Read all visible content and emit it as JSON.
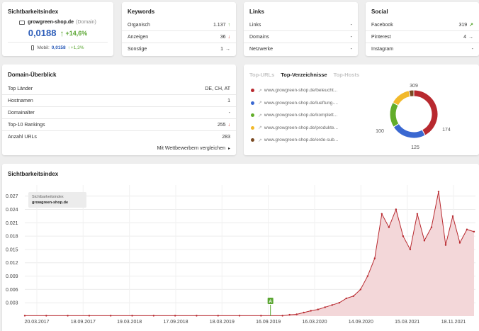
{
  "sichtbarkeit_card": {
    "title": "Sichtbarkeitsindex",
    "domain": "growgreen-shop.de",
    "domain_suffix": "(Domain)",
    "value": "0,0188",
    "change": "+14,6%",
    "mobile_label": "Mobil:",
    "mobile_value": "0,0158",
    "mobile_change": "+1,3%"
  },
  "keywords_card": {
    "title": "Keywords",
    "rows": [
      {
        "label": "Organisch",
        "value": "1.137",
        "trend": "↑",
        "trend_type": "up"
      },
      {
        "label": "Anzeigen",
        "value": "36",
        "trend": "↓",
        "trend_type": "down"
      },
      {
        "label": "Sonstige",
        "value": "1",
        "trend": "→",
        "trend_type": "right"
      }
    ]
  },
  "links_card": {
    "title": "Links",
    "rows": [
      {
        "label": "Links",
        "value": "-"
      },
      {
        "label": "Domains",
        "value": "-"
      },
      {
        "label": "Netzwerke",
        "value": "-"
      }
    ]
  },
  "social_card": {
    "title": "Social",
    "rows": [
      {
        "label": "Facebook",
        "value": "319",
        "trend": "↗",
        "trend_type": "up"
      },
      {
        "label": "Pinterest",
        "value": "4",
        "trend": "→",
        "trend_type": "right"
      },
      {
        "label": "Instagram",
        "value": "-",
        "trend": "",
        "trend_type": ""
      }
    ]
  },
  "domain_card": {
    "title": "Domain-Überblick",
    "rows": [
      {
        "label": "Top Länder",
        "value": "DE, CH, AT",
        "trend": "",
        "trend_type": ""
      },
      {
        "label": "Hostnamen",
        "value": "1",
        "trend": "",
        "trend_type": ""
      },
      {
        "label": "Domainalter",
        "value": "-",
        "trend": "",
        "trend_type": ""
      },
      {
        "label": "Top-10 Rankings",
        "value": "255",
        "trend": "↓",
        "trend_type": "down"
      },
      {
        "label": "Anzahl URLs",
        "value": "283",
        "trend": "",
        "trend_type": ""
      }
    ],
    "compare_link": "Mit Wettbewerbern vergleichen",
    "compare_arrow": "▸"
  },
  "top_card": {
    "tabs": [
      "Top-URLs",
      "Top-Verzeichnisse",
      "Top-Hosts"
    ],
    "active_tab": 1,
    "items": [
      {
        "url": "www.growgreen-shop.de/beleucht...",
        "color": "#b8292f"
      },
      {
        "url": "www.growgreen-shop.de/lueftung-...",
        "color": "#3a68d1"
      },
      {
        "url": "www.growgreen-shop.de/komplett...",
        "color": "#62ad2a"
      },
      {
        "url": "www.growgreen-shop.de/produkte...",
        "color": "#f2b92b"
      },
      {
        "url": "www.growgreen-shop.de/erde-sub...",
        "color": "#7a4a22"
      }
    ],
    "donut": {
      "values": [
        309,
        174,
        125,
        100,
        24
      ],
      "labels": [
        "309",
        "174",
        "125",
        "100"
      ]
    }
  },
  "chart_card": {
    "title": "Sichtbarkeitsindex",
    "legend_series_label": "Sichtbarkeitsindex",
    "legend_domain": "growgreen-shop.de",
    "marker_label": "A"
  },
  "chart_data": {
    "type": "area",
    "title": "Sichtbarkeitsindex",
    "series": [
      {
        "name": "growgreen-shop.de"
      }
    ],
    "y_ticks": [
      "0.027",
      "0.024",
      "0.021",
      "0.018",
      "0.015",
      "0.012",
      "0.009",
      "0.006",
      "0.003"
    ],
    "ylim": [
      0,
      0.0295
    ],
    "x_ticks": [
      "20.03.2017",
      "18.09.2017",
      "19.03.2018",
      "17.09.2018",
      "18.03.2019",
      "16.09.2019",
      "16.03.2020",
      "14.09.2020",
      "15.03.2021",
      "18.11.2021"
    ],
    "x": [
      "2016-12",
      "2017-03",
      "2017-06",
      "2017-09",
      "2017-12",
      "2018-03",
      "2018-06",
      "2018-09",
      "2018-12",
      "2019-03",
      "2019-06",
      "2019-09",
      "2019-12",
      "2020-03",
      "2020-05",
      "2020-07",
      "2020-08",
      "2020-09",
      "2020-10",
      "2020-11",
      "2020-12",
      "2021-01",
      "2021-02",
      "2021-03",
      "2021-04",
      "2021-05",
      "2021-06",
      "2021-06b",
      "2021-07",
      "2021-07b",
      "2021-08",
      "2021-08b",
      "2021-09",
      "2021-09b",
      "2021-10",
      "2021-10b",
      "2021-11",
      "2021-11b",
      "2021-12",
      "2022-01"
    ],
    "y": [
      0.0001,
      0.0001,
      0.0001,
      0.0001,
      0.0001,
      0.0001,
      0.0001,
      0.0001,
      0.0001,
      0.0001,
      0.0001,
      0.0001,
      0.0001,
      0.0003,
      0.0004,
      0.0008,
      0.0012,
      0.0015,
      0.002,
      0.0025,
      0.003,
      0.004,
      0.0045,
      0.006,
      0.009,
      0.013,
      0.023,
      0.02,
      0.024,
      0.018,
      0.015,
      0.023,
      0.017,
      0.02,
      0.028,
      0.016,
      0.0225,
      0.0165,
      0.0195,
      0.019
    ],
    "annotation": {
      "x_label": "16.09.2019",
      "text": "A"
    },
    "grid": true,
    "colors": {
      "line": "#b8292f",
      "fill": "#f3d7d9"
    }
  }
}
